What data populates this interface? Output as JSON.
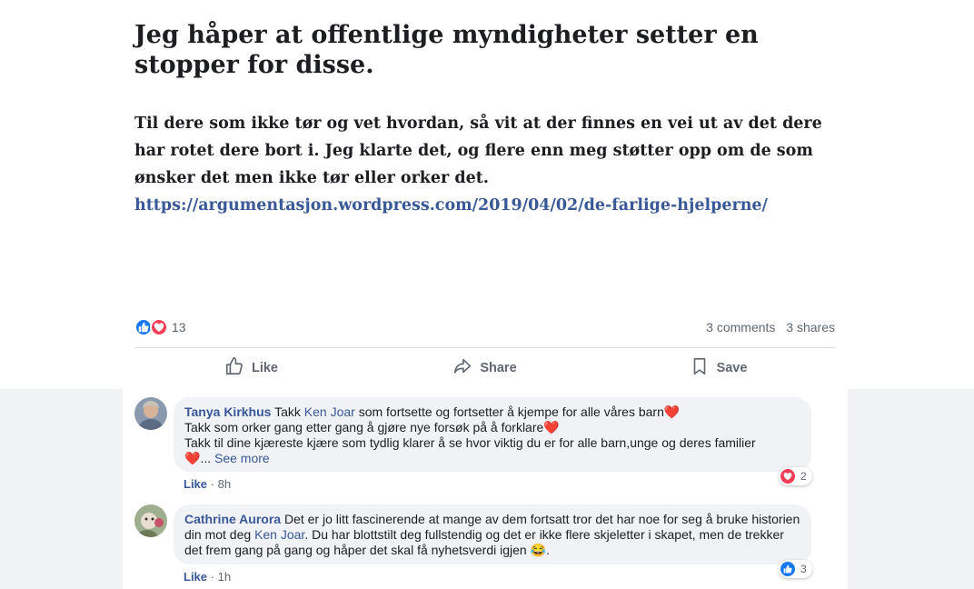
{
  "post": {
    "title": "Jeg håper at offentlige myndigheter setter en stopper for disse.",
    "body": "Til dere som ikke tør og vet hvordan, så vit at der finnes en vei ut av det dere har rotet dere bort i. Jeg klarte det, og flere enn meg støtter opp om de som ønsker det men ikke tør eller orker det.",
    "link": "https://argumentasjon.wordpress.com/2019/04/02/de-farlige-hjelperne/"
  },
  "stats": {
    "reaction_count": "13",
    "comments": "3 comments",
    "shares": "3 shares"
  },
  "actions": {
    "like": "Like",
    "share": "Share",
    "save": "Save"
  },
  "comments": [
    {
      "author": "Tanya Kirkhus",
      "prefix": "Takk",
      "mention": "Ken Joar",
      "line1_rest": "som fortsette og fortsetter å kjempe for alle våres barn",
      "line2": "Takk som orker gang etter gang å gjøre nye forsøk på å forklare",
      "line3": "Takk til dine kjæreste kjære som tydlig klarer å se hvor viktig du er for alle barn,unge og deres familier",
      "ellipsis": "...",
      "see_more": "See more",
      "like_label": "Like",
      "separator": "·",
      "time": "8h",
      "reaction_count": "2",
      "reaction_type": "love-icon"
    },
    {
      "author": "Cathrine Aurora",
      "text_start": "Det er jo litt fascinerende at mange av dem fortsatt tror det har noe for seg å bruke historien din mot deg",
      "mention": "Ken Joar",
      "text_end": ". Du har blottstilt deg fullstendig og det er ikke flere skjeletter i skapet, men de trekker det frem gang på gang og håper det skal få nyhetsverdi igjen",
      "emoji": "😂",
      "end_punct": ".",
      "like_label": "Like",
      "separator": "·",
      "time": "1h",
      "reaction_count": "3",
      "reaction_type": "like-icon"
    }
  ],
  "colors": {
    "link": "#385898",
    "like_blue": "#1877f2",
    "love_red": "#f33e58",
    "muted": "#606770",
    "bubble": "#f0f2f5"
  }
}
